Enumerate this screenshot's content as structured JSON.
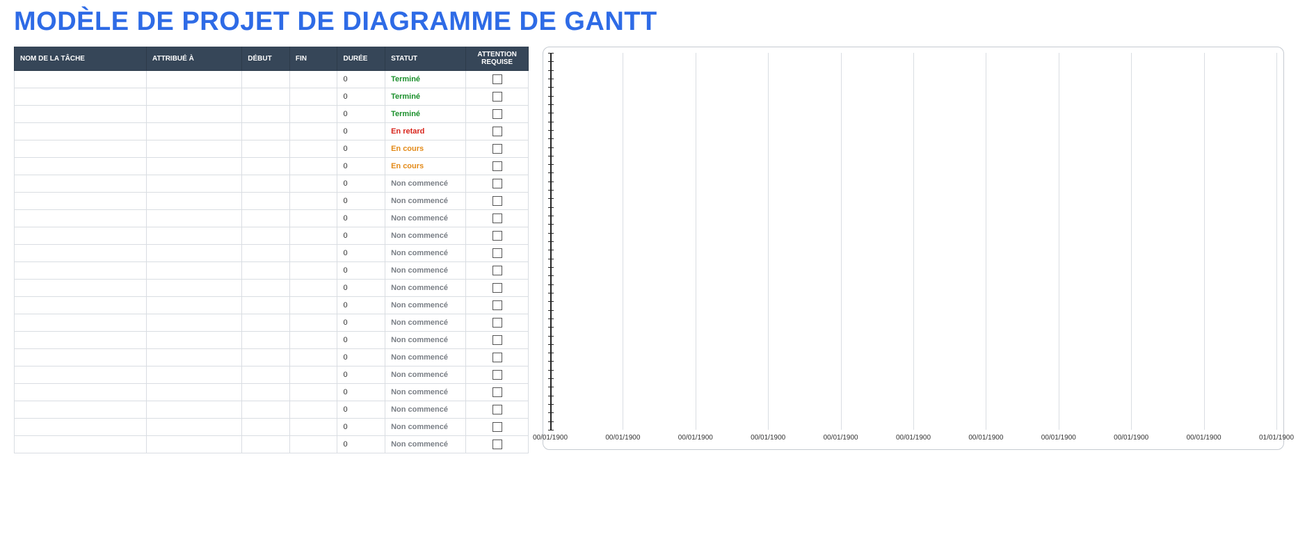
{
  "title": "MODÈLE DE PROJET DE DIAGRAMME DE GANTT",
  "table": {
    "headers": {
      "task": "NOM DE LA TÂCHE",
      "assigned": "ATTRIBUÉ À",
      "start": "DÉBUT",
      "end": "FIN",
      "duration": "DURÉE",
      "status": "STATUT",
      "attention": "ATTENTION REQUISE"
    },
    "rows": [
      {
        "task": "",
        "assigned": "",
        "start": "",
        "end": "",
        "duration": "0",
        "status": "Terminé",
        "status_color": "#1a8f2b",
        "attention": false
      },
      {
        "task": "",
        "assigned": "",
        "start": "",
        "end": "",
        "duration": "0",
        "status": "Terminé",
        "status_color": "#1a8f2b",
        "attention": false
      },
      {
        "task": "",
        "assigned": "",
        "start": "",
        "end": "",
        "duration": "0",
        "status": "Terminé",
        "status_color": "#1a8f2b",
        "attention": false
      },
      {
        "task": "",
        "assigned": "",
        "start": "",
        "end": "",
        "duration": "0",
        "status": "En retard",
        "status_color": "#d8261d",
        "attention": false
      },
      {
        "task": "",
        "assigned": "",
        "start": "",
        "end": "",
        "duration": "0",
        "status": "En cours",
        "status_color": "#e38a18",
        "attention": false
      },
      {
        "task": "",
        "assigned": "",
        "start": "",
        "end": "",
        "duration": "0",
        "status": "En cours",
        "status_color": "#e38a18",
        "attention": false
      },
      {
        "task": "",
        "assigned": "",
        "start": "",
        "end": "",
        "duration": "0",
        "status": "Non commencé",
        "status_color": "#7a7f86",
        "attention": false
      },
      {
        "task": "",
        "assigned": "",
        "start": "",
        "end": "",
        "duration": "0",
        "status": "Non commencé",
        "status_color": "#7a7f86",
        "attention": false
      },
      {
        "task": "",
        "assigned": "",
        "start": "",
        "end": "",
        "duration": "0",
        "status": "Non commencé",
        "status_color": "#7a7f86",
        "attention": false
      },
      {
        "task": "",
        "assigned": "",
        "start": "",
        "end": "",
        "duration": "0",
        "status": "Non commencé",
        "status_color": "#7a7f86",
        "attention": false
      },
      {
        "task": "",
        "assigned": "",
        "start": "",
        "end": "",
        "duration": "0",
        "status": "Non commencé",
        "status_color": "#7a7f86",
        "attention": false
      },
      {
        "task": "",
        "assigned": "",
        "start": "",
        "end": "",
        "duration": "0",
        "status": "Non commencé",
        "status_color": "#7a7f86",
        "attention": false
      },
      {
        "task": "",
        "assigned": "",
        "start": "",
        "end": "",
        "duration": "0",
        "status": "Non commencé",
        "status_color": "#7a7f86",
        "attention": false
      },
      {
        "task": "",
        "assigned": "",
        "start": "",
        "end": "",
        "duration": "0",
        "status": "Non commencé",
        "status_color": "#7a7f86",
        "attention": false
      },
      {
        "task": "",
        "assigned": "",
        "start": "",
        "end": "",
        "duration": "0",
        "status": "Non commencé",
        "status_color": "#7a7f86",
        "attention": false
      },
      {
        "task": "",
        "assigned": "",
        "start": "",
        "end": "",
        "duration": "0",
        "status": "Non commencé",
        "status_color": "#7a7f86",
        "attention": false
      },
      {
        "task": "",
        "assigned": "",
        "start": "",
        "end": "",
        "duration": "0",
        "status": "Non commencé",
        "status_color": "#7a7f86",
        "attention": false
      },
      {
        "task": "",
        "assigned": "",
        "start": "",
        "end": "",
        "duration": "0",
        "status": "Non commencé",
        "status_color": "#7a7f86",
        "attention": false
      },
      {
        "task": "",
        "assigned": "",
        "start": "",
        "end": "",
        "duration": "0",
        "status": "Non commencé",
        "status_color": "#7a7f86",
        "attention": false
      },
      {
        "task": "",
        "assigned": "",
        "start": "",
        "end": "",
        "duration": "0",
        "status": "Non commencé",
        "status_color": "#7a7f86",
        "attention": false
      },
      {
        "task": "",
        "assigned": "",
        "start": "",
        "end": "",
        "duration": "0",
        "status": "Non commencé",
        "status_color": "#7a7f86",
        "attention": false
      },
      {
        "task": "",
        "assigned": "",
        "start": "",
        "end": "",
        "duration": "0",
        "status": "Non commencé",
        "status_color": "#7a7f86",
        "attention": false
      }
    ]
  },
  "chart": {
    "x_ticks": [
      "00/01/1900",
      "00/01/1900",
      "00/01/1900",
      "00/01/1900",
      "00/01/1900",
      "00/01/1900",
      "00/01/1900",
      "00/01/1900",
      "00/01/1900",
      "00/01/1900",
      "01/01/1900"
    ],
    "y_tick_count": 44
  }
}
